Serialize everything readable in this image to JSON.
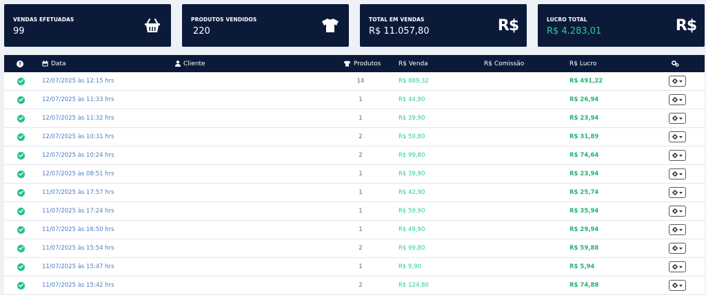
{
  "cards": [
    {
      "label": "VENDAS EFETUADAS",
      "value": "99",
      "icon": "basket-icon",
      "value_color": "white"
    },
    {
      "label": "PRODUTOS VENDIDOS",
      "value": "220",
      "icon": "tshirt-icon",
      "value_color": "white"
    },
    {
      "label": "TOTAL EM VENDAS",
      "value": "R$ 11.057,80",
      "icon": "R$",
      "value_color": "white"
    },
    {
      "label": "LUCRO TOTAL",
      "value": "R$ 4.283,01",
      "icon": "R$",
      "value_color": "green"
    }
  ],
  "table": {
    "headers": {
      "status": "?",
      "data": "Data",
      "cliente": "Cliente",
      "produtos": "Produtos",
      "venda": "R$ Venda",
      "comissao": "R$ Comissão",
      "lucro": "R$ Lucro"
    },
    "rows": [
      {
        "date": "12/07/2025 às 12:15 hrs",
        "produtos": "14",
        "venda": "R$ 889,32",
        "lucro": "R$ 491,22"
      },
      {
        "date": "12/07/2025 às 11:33 hrs",
        "produtos": "1",
        "venda": "R$ 44,90",
        "lucro": "R$ 26,94"
      },
      {
        "date": "12/07/2025 às 11:32 hrs",
        "produtos": "1",
        "venda": "R$ 39,90",
        "lucro": "R$ 23,94"
      },
      {
        "date": "12/07/2025 às 10:31 hrs",
        "produtos": "2",
        "venda": "R$ 59,80",
        "lucro": "R$ 31,89"
      },
      {
        "date": "12/07/2025 às 10:24 hrs",
        "produtos": "2",
        "venda": "R$ 99,80",
        "lucro": "R$ 74,64"
      },
      {
        "date": "12/07/2025 às 08:51 hrs",
        "produtos": "1",
        "venda": "R$ 39,90",
        "lucro": "R$ 23,94"
      },
      {
        "date": "11/07/2025 às 17:57 hrs",
        "produtos": "1",
        "venda": "R$ 42,90",
        "lucro": "R$ 25,74"
      },
      {
        "date": "11/07/2025 às 17:24 hrs",
        "produtos": "1",
        "venda": "R$ 59,90",
        "lucro": "R$ 35,94"
      },
      {
        "date": "11/07/2025 às 16:50 hrs",
        "produtos": "1",
        "venda": "R$ 49,90",
        "lucro": "R$ 29,94"
      },
      {
        "date": "11/07/2025 às 15:54 hrs",
        "produtos": "2",
        "venda": "R$ 99,80",
        "lucro": "R$ 59,88"
      },
      {
        "date": "11/07/2025 às 15:47 hrs",
        "produtos": "1",
        "venda": "R$ 9,90",
        "lucro": "R$ 5,94"
      },
      {
        "date": "11/07/2025 às 15:42 hrs",
        "produtos": "2",
        "venda": "R$ 124,80",
        "lucro": "R$ 74,88"
      }
    ]
  },
  "colors": {
    "navy": "#0c1a3a",
    "green": "#22c282",
    "link": "#4a7fbf"
  }
}
